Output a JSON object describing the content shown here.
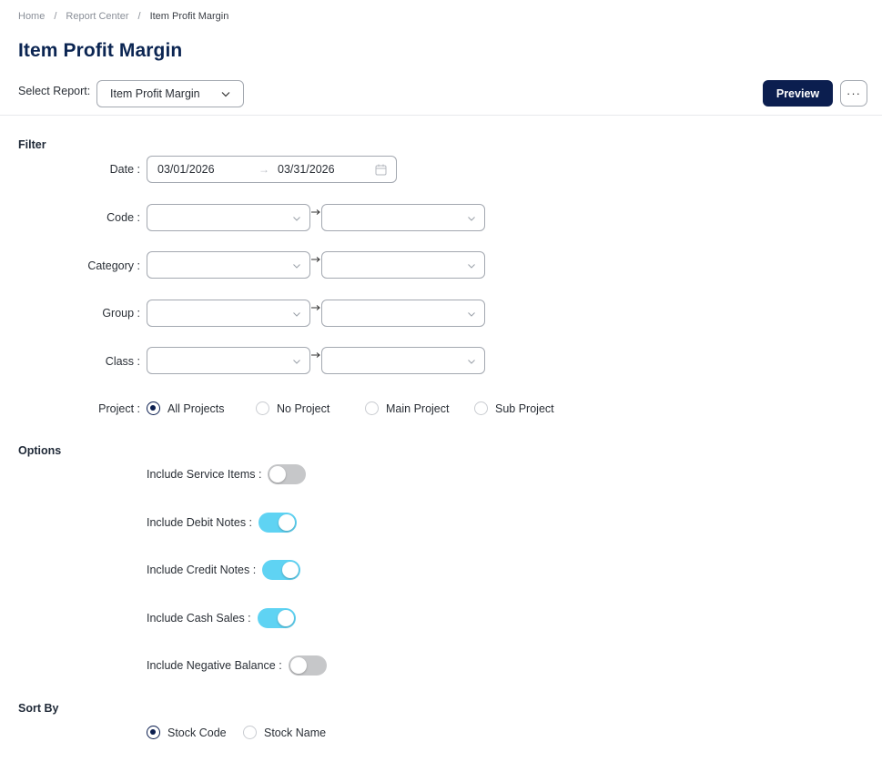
{
  "breadcrumb": [
    "Home",
    "Report Center",
    "Item Profit Margin"
  ],
  "page_title": "Item Profit Margin",
  "report_selector": {
    "label": "Select Report:",
    "value": "Item Profit Margin"
  },
  "actions": {
    "preview_label": "Preview",
    "more_label": "···"
  },
  "filter": {
    "title": "Filter",
    "date": {
      "label": "Date :",
      "from": "03/01/2026",
      "arrow": "→",
      "to": "03/31/2026"
    },
    "ranges": [
      {
        "label": "Code :"
      },
      {
        "label": "Category :"
      },
      {
        "label": "Group :"
      },
      {
        "label": "Class :"
      }
    ],
    "project": {
      "label": "Project :",
      "options": [
        "All Projects",
        "No Project",
        "Main Project",
        "Sub Project"
      ],
      "selected": "All Projects"
    }
  },
  "options": {
    "title": "Options",
    "toggles": [
      {
        "label": "Include Service Items :",
        "on": false
      },
      {
        "label": "Include Debit Notes :",
        "on": true
      },
      {
        "label": "Include Credit Notes :",
        "on": true
      },
      {
        "label": "Include Cash Sales :",
        "on": true
      },
      {
        "label": "Include Negative Balance :",
        "on": false
      }
    ]
  },
  "sort_by": {
    "title": "Sort By",
    "options": [
      "Stock Code",
      "Stock Name"
    ],
    "selected": "Stock Code"
  },
  "colors": {
    "primary": "#0b1e4f",
    "title": "#0b2552",
    "toggle_on": "#5fd3f3",
    "toggle_off": "#c6c7c9"
  }
}
